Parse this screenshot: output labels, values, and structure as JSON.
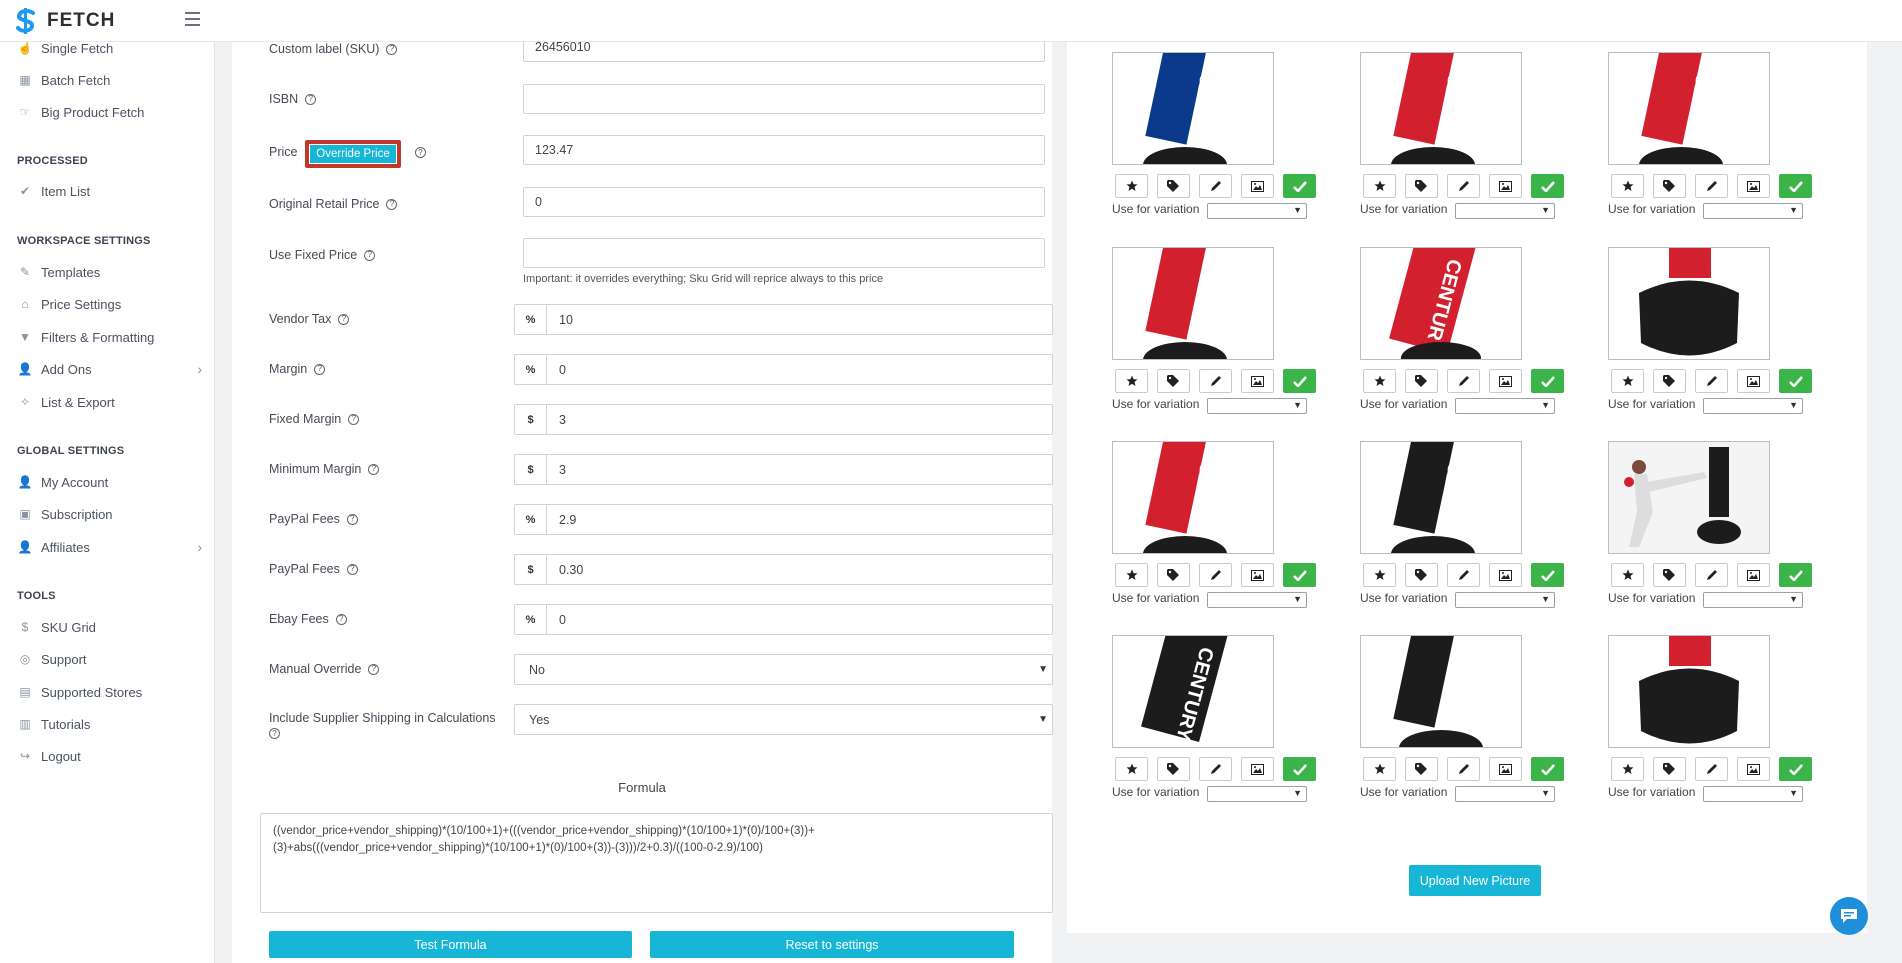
{
  "app": {
    "brand": "FETCH"
  },
  "sidebar": {
    "items_top": [
      {
        "label": "Single Fetch",
        "icon": "hand-icon"
      },
      {
        "label": "Batch Fetch",
        "icon": "batch-icon"
      },
      {
        "label": "Big Product Fetch",
        "icon": "pointer-icon"
      }
    ],
    "processed_heading": "PROCESSED",
    "processed_items": [
      {
        "label": "Item List",
        "icon": "checklist-icon"
      }
    ],
    "workspace_heading": "WORKSPACE SETTINGS",
    "workspace_items": [
      {
        "label": "Templates",
        "icon": "brush-icon"
      },
      {
        "label": "Price Settings",
        "icon": "tag-icon"
      },
      {
        "label": "Filters & Formatting",
        "icon": "filter-icon"
      },
      {
        "label": "Add Ons",
        "icon": "user-plus-icon"
      },
      {
        "label": "List & Export",
        "icon": "wand-icon"
      }
    ],
    "global_heading": "GLOBAL SETTINGS",
    "global_items": [
      {
        "label": "My Account",
        "icon": "user-icon"
      },
      {
        "label": "Subscription",
        "icon": "subscription-icon"
      },
      {
        "label": "Affiliates",
        "icon": "affiliates-icon"
      }
    ],
    "tools_heading": "TOOLS",
    "tools_items": [
      {
        "label": "SKU Grid",
        "icon": "dollar-icon"
      },
      {
        "label": "Support",
        "icon": "globe-icon"
      },
      {
        "label": "Supported Stores",
        "icon": "store-icon"
      },
      {
        "label": "Tutorials",
        "icon": "books-icon"
      },
      {
        "label": "Logout",
        "icon": "logout-icon"
      }
    ]
  },
  "form": {
    "custom_label": {
      "label": "Custom label (SKU)",
      "value": "26456010"
    },
    "isbn": {
      "label": "ISBN",
      "value": ""
    },
    "price": {
      "label": "Price",
      "override_label": "Override Price",
      "value": "123.47"
    },
    "original_retail": {
      "label": "Original Retail Price",
      "value": "0"
    },
    "fixed_price": {
      "label": "Use Fixed Price",
      "value": "",
      "note": "Important: it overrides everything; Sku Grid will reprice always to this price"
    },
    "vendor_tax": {
      "label": "Vendor Tax",
      "addon": "%",
      "value": "10"
    },
    "margin": {
      "label": "Margin",
      "addon": "%",
      "value": "0"
    },
    "fixed_margin": {
      "label": "Fixed Margin",
      "addon": "$",
      "value": "3"
    },
    "minimum_margin": {
      "label": "Minimum Margin",
      "addon": "$",
      "value": "3"
    },
    "paypal_pct": {
      "label": "PayPal Fees",
      "addon": "%",
      "value": "2.9"
    },
    "paypal_fixed": {
      "label": "PayPal Fees",
      "addon": "$",
      "value": "0.30"
    },
    "ebay_fees": {
      "label": "Ebay Fees",
      "addon": "%",
      "value": "0"
    },
    "manual_override": {
      "label": "Manual Override",
      "value": "No"
    },
    "include_shipping": {
      "label": "Include Supplier Shipping in Calculations",
      "value": "Yes"
    },
    "formula_title": "Formula",
    "formula_text": "((vendor_price+vendor_shipping)*(10/100+1)+(((vendor_price+vendor_shipping)*(10/100+1)*(0)/100+(3))+\n(3)+abs(((vendor_price+vendor_shipping)*(10/100+1)*(0)/100+(3))-(3)))/2+0.3)/((100-0-2.9)/100)",
    "test_button": "Test Formula",
    "reset_button": "Reset to settings"
  },
  "pictures": {
    "variation_label": "Use for variation",
    "upload_button": "Upload New Picture",
    "items": [
      {
        "variant": "blue-bag"
      },
      {
        "variant": "red-bag"
      },
      {
        "variant": "red-bag"
      },
      {
        "variant": "red-plain"
      },
      {
        "variant": "red-bag-close"
      },
      {
        "variant": "black-base"
      },
      {
        "variant": "red-bag"
      },
      {
        "variant": "black-bag"
      },
      {
        "variant": "kick-photo"
      },
      {
        "variant": "black-bag-close"
      },
      {
        "variant": "black-plain"
      },
      {
        "variant": "black-base"
      }
    ],
    "colors": {
      "blue": "#0b3a8c",
      "red": "#d3202f",
      "black": "#1c1c1c",
      "check": "#3bb54a",
      "accent": "#17b5d6"
    }
  }
}
